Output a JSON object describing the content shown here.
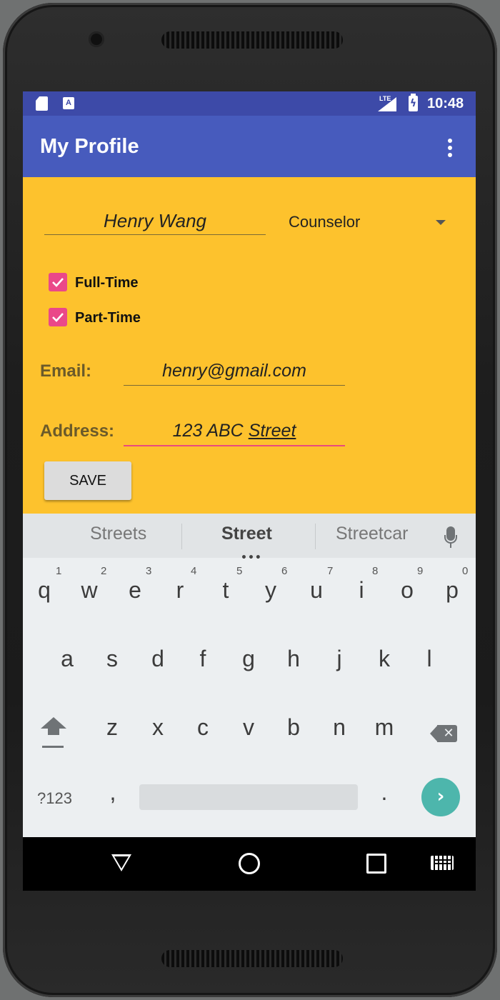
{
  "status_bar": {
    "time": "10:48",
    "network": "LTE",
    "icons": [
      "sd-card-icon",
      "a-notification-icon",
      "signal-icon",
      "battery-charging-icon"
    ]
  },
  "app_bar": {
    "title": "My Profile",
    "menu_icon": "more-vert-icon"
  },
  "form": {
    "name_value": "Henry Wang",
    "role_selected": "Counselor",
    "full_time": {
      "label": "Full-Time",
      "checked": true
    },
    "part_time": {
      "label": "Part-Time",
      "checked": true
    },
    "email_label": "Email:",
    "email_value": "henry@gmail.com",
    "address_label": "Address:",
    "address_prefix": "123 ABC ",
    "address_underlined": "Street",
    "save_label": "SAVE"
  },
  "keyboard": {
    "suggestions": [
      "Streets",
      "Street",
      "Streetcar"
    ],
    "row1": [
      "q",
      "w",
      "e",
      "r",
      "t",
      "y",
      "u",
      "i",
      "o",
      "p"
    ],
    "row1_hints": [
      "1",
      "2",
      "3",
      "4",
      "5",
      "6",
      "7",
      "8",
      "9",
      "0"
    ],
    "row2": [
      "a",
      "s",
      "d",
      "f",
      "g",
      "h",
      "j",
      "k",
      "l"
    ],
    "row3": [
      "z",
      "x",
      "c",
      "v",
      "b",
      "n",
      "m"
    ],
    "symbols_key": "?123",
    "comma_key": ",",
    "period_key": ".",
    "accent": "#4db6ac"
  },
  "colors": {
    "status_bar": "#3d4aa8",
    "app_bar": "#475bbd",
    "background": "#fdc22d",
    "checkbox": "#ea4889",
    "address_underline": "#e84b7d"
  }
}
